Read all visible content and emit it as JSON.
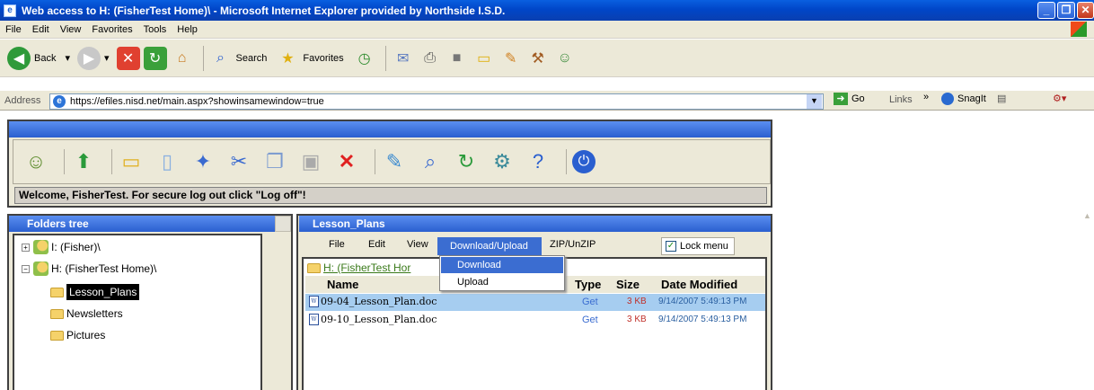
{
  "window": {
    "title": "Web access to H: (FisherTest Home)\\  - Microsoft Internet Explorer provided by Northside I.S.D."
  },
  "menubar": [
    "File",
    "Edit",
    "View",
    "Favorites",
    "Tools",
    "Help"
  ],
  "toolbar": {
    "back": "Back",
    "search": "Search",
    "favorites": "Favorites"
  },
  "address": {
    "label": "Address",
    "url": "https://efiles.nisd.net/main.aspx?showinsamewindow=true",
    "go": "Go",
    "links": "Links",
    "snagit": "SnagIt"
  },
  "app": {
    "welcome": "Welcome, FisherTest. For secure log out click \"Log off\"!"
  },
  "folders": {
    "title": "Folders tree",
    "items": [
      {
        "label": "I: (Fisher)\\"
      },
      {
        "label": "H: (FisherTest Home)\\"
      },
      {
        "label": "Lesson_Plans"
      },
      {
        "label": "Newsletters"
      },
      {
        "label": "Pictures"
      }
    ]
  },
  "files": {
    "title": "Lesson_Plans",
    "menu": [
      "File",
      "Edit",
      "View",
      "Download/Upload",
      "ZIP/UnZIP"
    ],
    "lock_menu": "Lock menu",
    "path": "H: (FisherTest Hor",
    "dropdown": [
      "Download",
      "Upload"
    ],
    "columns": [
      "Name",
      "Type",
      "Size",
      "Date Modified"
    ],
    "rows": [
      {
        "name": "09-04_Lesson_Plan.doc",
        "type": "Get",
        "size": "3 KB",
        "date": "9/14/2007 5:49:13 PM"
      },
      {
        "name": "09-10_Lesson_Plan.doc",
        "type": "Get",
        "size": "3 KB",
        "date": "9/14/2007 5:49:13 PM"
      }
    ]
  },
  "colors": {
    "title_blue": "#0046c8",
    "panel_header": "#2a5fcf",
    "selection": "#3b6dd1",
    "row_highlight": "#a6cdf0"
  }
}
